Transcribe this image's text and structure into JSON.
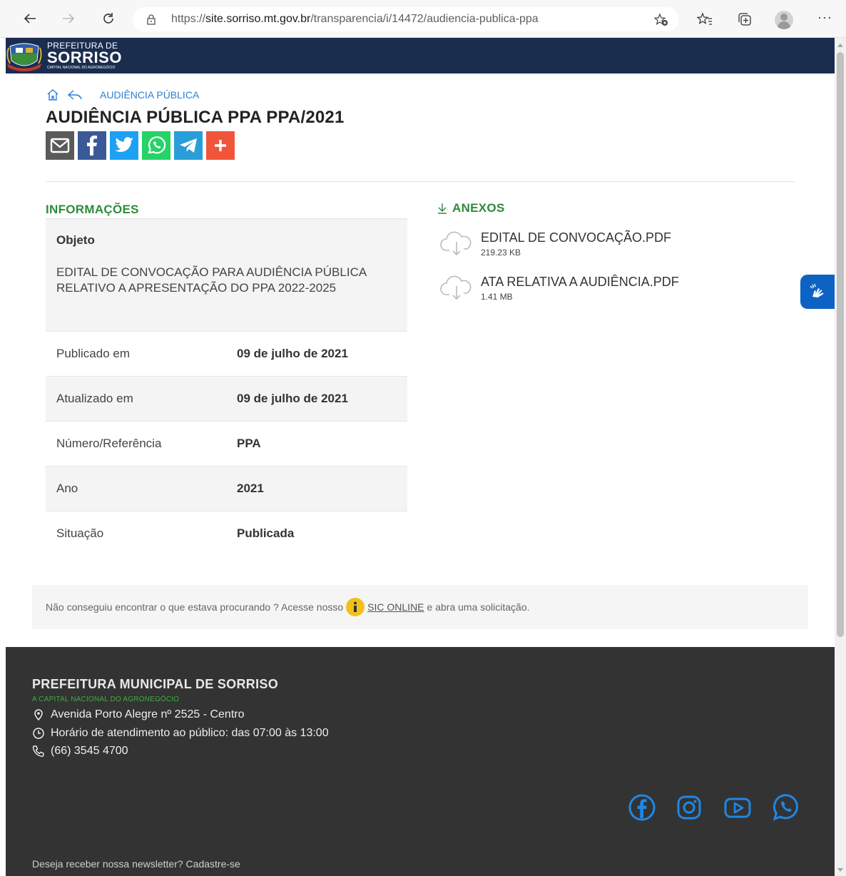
{
  "browser": {
    "url_scheme": "https://",
    "url_host": "site.sorriso.mt.gov.br",
    "url_path": "/transparencia/i/14472/audiencia-publica-ppa"
  },
  "header": {
    "logo_small": "PREFEITURA DE",
    "logo_big": "SORRISO",
    "logo_tiny": "CAPITAL NACIONAL DO AGRONEGÓCIO"
  },
  "breadcrumb": {
    "link": "AUDIÊNCIA PÚBLICA"
  },
  "page": {
    "title": "AUDIÊNCIA PÚBLICA PPA PPA/2021"
  },
  "share": {
    "buttons": [
      {
        "name": "email",
        "color": "#5a5a5a"
      },
      {
        "name": "facebook",
        "color": "#3b5998"
      },
      {
        "name": "twitter",
        "color": "#1da1f2"
      },
      {
        "name": "whatsapp",
        "color": "#25d366"
      },
      {
        "name": "telegram",
        "color": "#2a9ed8"
      },
      {
        "name": "more",
        "color": "#f0553a"
      }
    ]
  },
  "info": {
    "title": "INFORMAÇÕES",
    "objeto_label": "Objeto",
    "objeto_text": "EDITAL DE CONVOCAÇÃO PARA AUDIÊNCIA PÚBLICA RELATIVO A APRESENTAÇÃO DO PPA 2022-2025",
    "rows": [
      {
        "label": "Publicado em",
        "value": "09 de julho de 2021"
      },
      {
        "label": "Atualizado em",
        "value": "09 de julho de 2021"
      },
      {
        "label": "Número/Referência",
        "value": "PPA"
      },
      {
        "label": "Ano",
        "value": "2021"
      },
      {
        "label": "Situação",
        "value": "Publicada"
      }
    ]
  },
  "anexos": {
    "title": "ANEXOS",
    "items": [
      {
        "name": "EDITAL DE CONVOCAÇÃO.PDF",
        "size": "219.23 KB"
      },
      {
        "name": "ATA RELATIVA A AUDIÊNCIA.PDF",
        "size": "1.41 MB"
      }
    ]
  },
  "sic": {
    "before": "Não conseguiu encontrar o que estava procurando ? Acesse nosso",
    "link": "SIC ONLINE",
    "after": "e abra uma solicitação."
  },
  "footer": {
    "title": "PREFEITURA MUNICIPAL DE SORRISO",
    "subtitle": "A CAPITAL NACIONAL DO AGRONEGÓCIO",
    "address": "Avenida Porto Alegre nº 2525 - Centro",
    "hours": "Horário de atendimento ao público: das 07:00 às 13:00",
    "phone": "(66) 3545 4700",
    "newsletter": "Deseja receber nossa newsletter? Cadastre-se",
    "social_color": "#1e88e5"
  },
  "colors": {
    "header_bg": "#1b2d4f",
    "accent_green": "#2e8b3a",
    "link_blue": "#2a7fd4",
    "footer_bg": "#333333"
  }
}
